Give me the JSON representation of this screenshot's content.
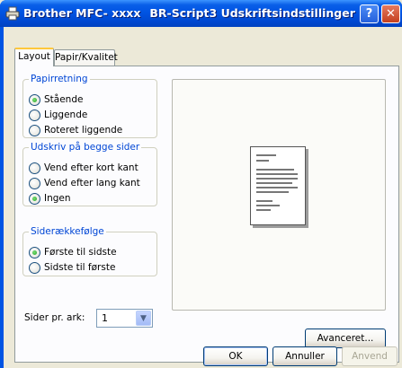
{
  "window": {
    "title_app": "Brother MFC- xxxx",
    "title_dialog": "BR-Script3 Udskriftsindstillinger",
    "help_label": "?",
    "close_label": "✕",
    "icon": "printer-icon"
  },
  "tabs": [
    {
      "label": "Layout",
      "active": true
    },
    {
      "label": "Papir/Kvalitet",
      "active": false
    }
  ],
  "orientation": {
    "legend": "Papirretning",
    "options": [
      "Stående",
      "Liggende",
      "Roteret liggende"
    ],
    "selected": "Stående"
  },
  "duplex": {
    "legend": "Udskriv på begge sider",
    "options": [
      "Vend efter kort kant",
      "Vend efter lang kant",
      "Ingen"
    ],
    "selected": "Ingen"
  },
  "page_order": {
    "legend": "Siderækkefølge",
    "options": [
      "Første til sidste",
      "Sidste til første"
    ],
    "selected": "Første til sidste"
  },
  "pages_per_sheet": {
    "label": "Sider pr. ark:",
    "value": "1"
  },
  "buttons": {
    "advanced": "Avanceret...",
    "ok": "OK",
    "cancel": "Annuller",
    "apply": "Anvend"
  }
}
